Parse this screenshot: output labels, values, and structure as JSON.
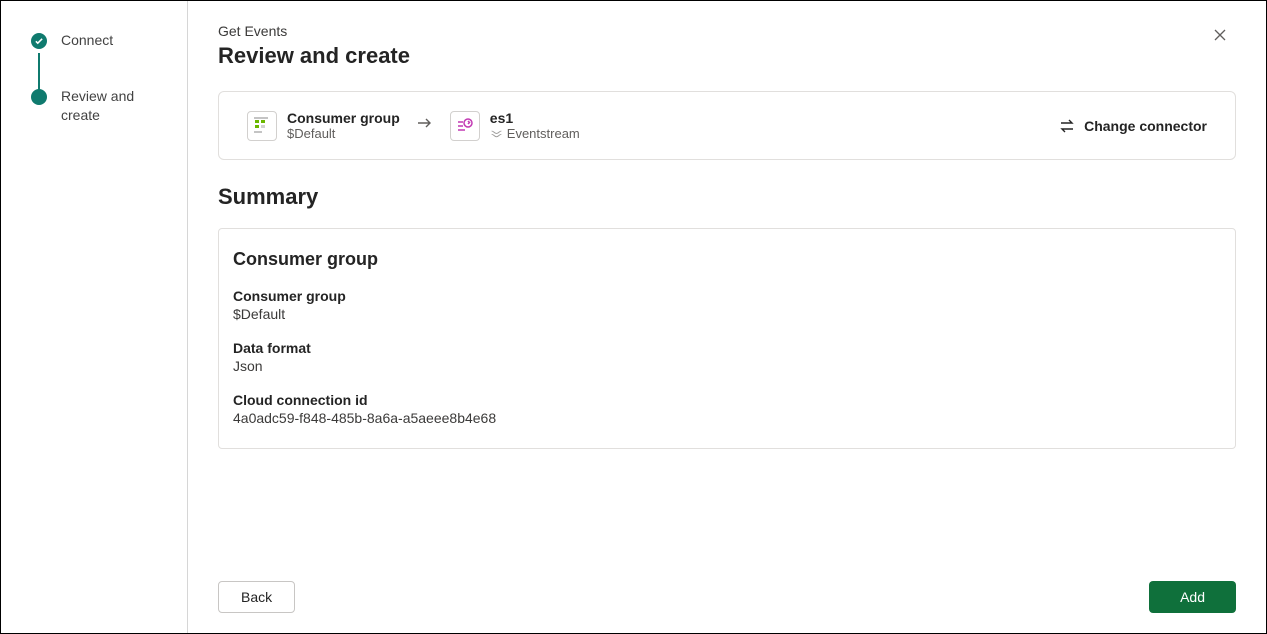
{
  "header": {
    "subtitle": "Get Events",
    "title": "Review and create"
  },
  "sidebar": {
    "steps": [
      {
        "label": "Connect",
        "state": "done"
      },
      {
        "label": "Review and create",
        "state": "current"
      }
    ]
  },
  "connector": {
    "source": {
      "title": "Consumer group",
      "value": "$Default",
      "icon": "consumer-group-icon"
    },
    "target": {
      "title": "es1",
      "sub": "Eventstream",
      "icon": "eventstream-icon"
    },
    "change_label": "Change connector"
  },
  "summary": {
    "heading": "Summary",
    "section_title": "Consumer group",
    "fields": [
      {
        "label": "Consumer group",
        "value": "$Default"
      },
      {
        "label": "Data format",
        "value": "Json"
      },
      {
        "label": "Cloud connection id",
        "value": "4a0adc59-f848-485b-8a6a-a5aeee8b4e68"
      }
    ]
  },
  "footer": {
    "back": "Back",
    "add": "Add"
  }
}
